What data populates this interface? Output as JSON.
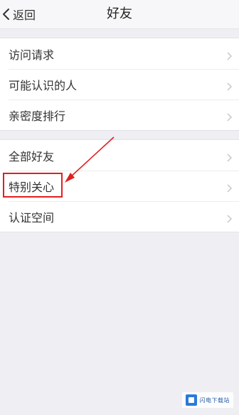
{
  "header": {
    "back_label": "返回",
    "title": "好友"
  },
  "groups": [
    {
      "items": [
        {
          "label": "访问请求"
        },
        {
          "label": "可能认识的人"
        },
        {
          "label": "亲密度排行"
        }
      ]
    },
    {
      "items": [
        {
          "label": "全部好友"
        },
        {
          "label": "特别关心"
        },
        {
          "label": "认证空间"
        }
      ]
    }
  ],
  "annotation": {
    "color": "#e02020"
  },
  "watermark": {
    "text": "闪电下载站"
  },
  "icons": {
    "back": "chevron-left-icon",
    "row": "chevron-right-icon"
  }
}
